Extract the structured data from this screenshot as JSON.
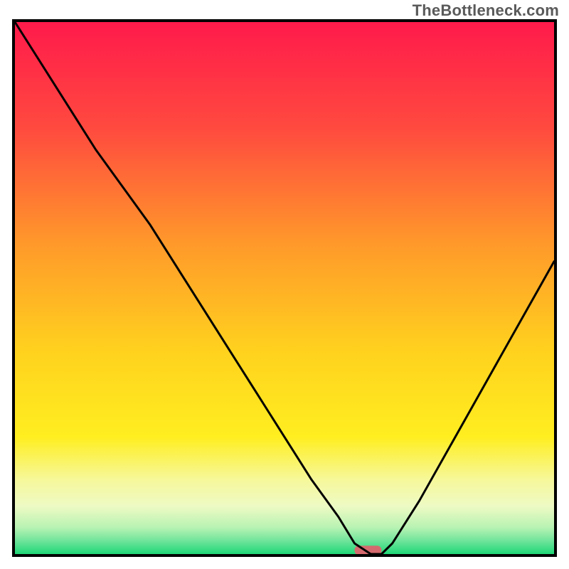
{
  "watermark": "TheBottleneck.com",
  "chart_data": {
    "type": "line",
    "title": "",
    "xlabel": "",
    "ylabel": "",
    "xlim": [
      0,
      100
    ],
    "ylim": [
      0,
      100
    ],
    "series": [
      {
        "name": "bottleneck-curve",
        "x": [
          0,
          5,
          10,
          15,
          20,
          25,
          30,
          35,
          40,
          45,
          50,
          55,
          60,
          63,
          66,
          68,
          70,
          75,
          80,
          85,
          90,
          95,
          100
        ],
        "y": [
          100,
          92,
          84,
          76,
          69,
          62,
          54,
          46,
          38,
          30,
          22,
          14,
          7,
          2,
          0,
          0,
          2,
          10,
          19,
          28,
          37,
          46,
          55
        ]
      }
    ],
    "marker": {
      "name": "optimum-marker",
      "x_range": [
        63,
        68
      ],
      "y": 0.7,
      "color": "#d46a6e"
    },
    "gradient_stops": [
      {
        "offset": 0.0,
        "color": "#ff1a4b"
      },
      {
        "offset": 0.2,
        "color": "#ff4a3f"
      },
      {
        "offset": 0.42,
        "color": "#ff9a2a"
      },
      {
        "offset": 0.62,
        "color": "#ffd21e"
      },
      {
        "offset": 0.78,
        "color": "#ffee20"
      },
      {
        "offset": 0.86,
        "color": "#f6f89a"
      },
      {
        "offset": 0.91,
        "color": "#eefac4"
      },
      {
        "offset": 0.95,
        "color": "#b8f3b3"
      },
      {
        "offset": 0.975,
        "color": "#6fe49b"
      },
      {
        "offset": 1.0,
        "color": "#1fd776"
      }
    ]
  }
}
